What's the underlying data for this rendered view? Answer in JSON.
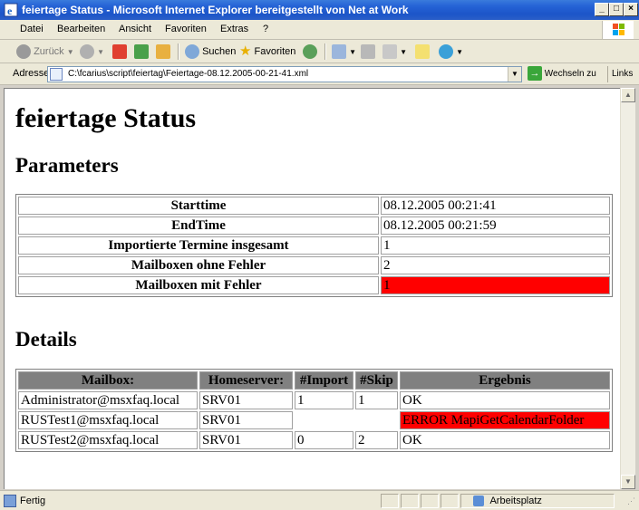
{
  "window": {
    "title": "feiertage Status - Microsoft Internet Explorer bereitgestellt von Net at Work"
  },
  "menu": {
    "items": [
      "Datei",
      "Bearbeiten",
      "Ansicht",
      "Favoriten",
      "Extras",
      "?"
    ]
  },
  "toolbar": {
    "back_label": "Zurück",
    "search_label": "Suchen",
    "favorites_label": "Favoriten"
  },
  "address": {
    "label": "Adresse",
    "value": "C:\\fcarius\\script\\feiertag\\Feiertage-08.12.2005-00-21-41.xml",
    "go_label": "Wechseln zu",
    "links_label": "Links"
  },
  "page": {
    "title": "feiertage Status",
    "parameters_heading": "Parameters",
    "parameters": [
      {
        "label": "Starttime",
        "value": "08.12.2005 00:21:41",
        "error": false
      },
      {
        "label": "EndTime",
        "value": "08.12.2005 00:21:59",
        "error": false
      },
      {
        "label": "Importierte Termine insgesamt",
        "value": "1",
        "error": false
      },
      {
        "label": "Mailboxen ohne Fehler",
        "value": "2",
        "error": false
      },
      {
        "label": "Mailboxen mit Fehler",
        "value": "1",
        "error": true
      }
    ],
    "details_heading": "Details",
    "details_columns": [
      "Mailbox:",
      "Homeserver:",
      "#Import",
      "#Skip",
      "Ergebnis"
    ],
    "details_rows": [
      {
        "mailbox": "Administrator@msxfaq.local",
        "server": "SRV01",
        "import": "1",
        "skip": "1",
        "result": "OK",
        "error": false
      },
      {
        "mailbox": "RUSTest1@msxfaq.local",
        "server": "SRV01",
        "import": "",
        "skip": "",
        "result": "ERROR MapiGetCalendarFolder",
        "error": true
      },
      {
        "mailbox": "RUSTest2@msxfaq.local",
        "server": "SRV01",
        "import": "0",
        "skip": "2",
        "result": "OK",
        "error": false
      }
    ]
  },
  "status": {
    "text": "Fertig",
    "zone": "Arbeitsplatz"
  },
  "colors": {
    "error": "#ff0000",
    "header_bg": "#808080",
    "titlebar": "#2563d6"
  }
}
